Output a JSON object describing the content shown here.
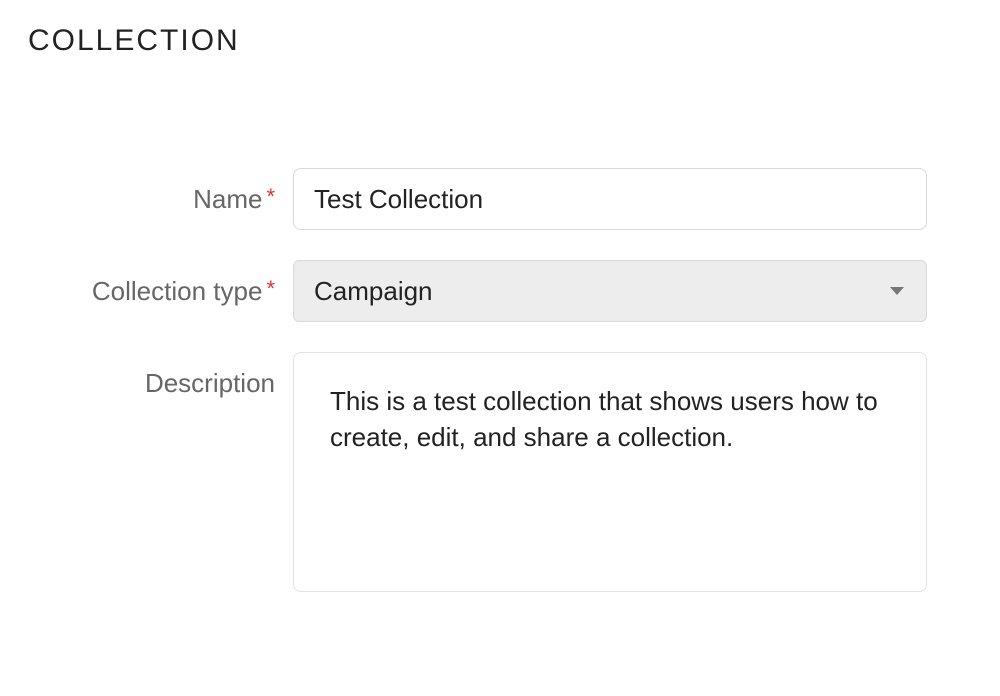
{
  "section_title": "COLLECTION",
  "form": {
    "name": {
      "label": "Name",
      "required_marker": "*",
      "value": "Test Collection"
    },
    "collection_type": {
      "label": "Collection type",
      "required_marker": "*",
      "selected": "Campaign"
    },
    "description": {
      "label": "Description",
      "value": "This is a test collection that shows users how to create, edit, and share a collection."
    }
  }
}
